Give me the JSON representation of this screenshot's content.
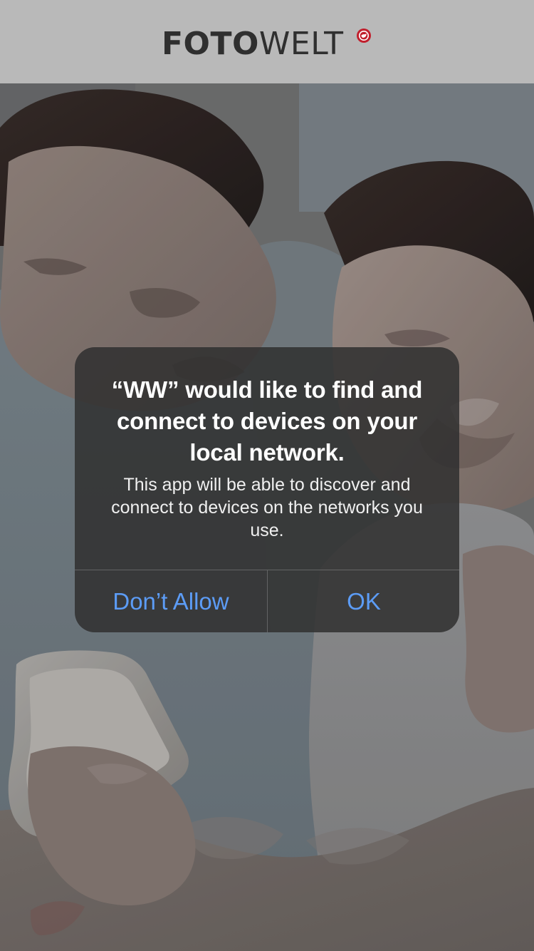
{
  "header": {
    "logo": {
      "bold": "FOTO",
      "light": "WELT"
    }
  },
  "alert": {
    "title": "“WW” would like to find and connect to devices on your local network.",
    "message": "This app will be able to discover and connect to devices on the networks you use.",
    "buttons": {
      "left": "Don’t Allow",
      "right": "OK"
    }
  },
  "colors": {
    "accent": "#5c9cf6",
    "header_bg": "#b9b9b9",
    "logo_mark": "#c11f2d"
  },
  "icons": {
    "logo_mark": "red-brand-mark-icon"
  }
}
